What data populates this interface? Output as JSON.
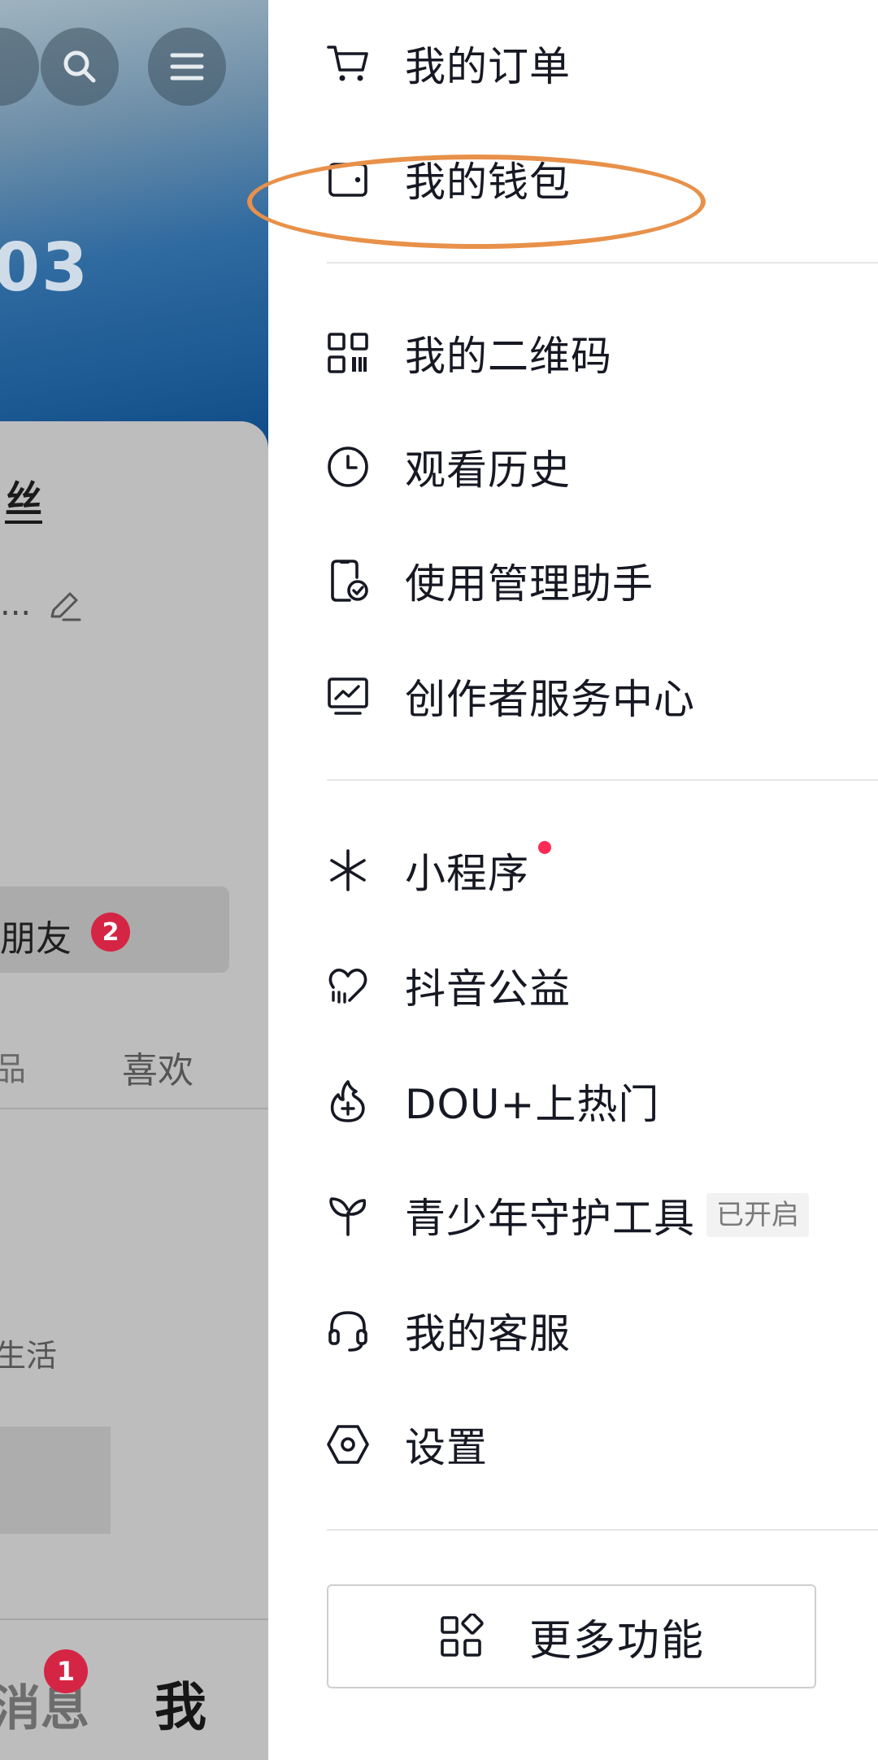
{
  "background": {
    "stat_number": "03",
    "fans_label": "丝",
    "bio_text": "...",
    "friend_button_label": "朋友",
    "friend_badge": "2",
    "tab_prev_label": "品",
    "tab_like_label": "喜欢",
    "life_text": "生活",
    "nav_messages_label": "消息",
    "nav_messages_badge": "1",
    "nav_me_label": "我"
  },
  "drawer": {
    "items": [
      {
        "label": "我的订单",
        "icon": "cart-icon"
      },
      {
        "label": "我的钱包",
        "icon": "wallet-icon"
      },
      {
        "label": "我的二维码",
        "icon": "qrcode-icon"
      },
      {
        "label": "观看历史",
        "icon": "clock-icon"
      },
      {
        "label": "使用管理助手",
        "icon": "phone-check-icon"
      },
      {
        "label": "创作者服务中心",
        "icon": "monitor-chart-icon"
      },
      {
        "label": "小程序",
        "icon": "sparkle-icon"
      },
      {
        "label": "抖音公益",
        "icon": "heart-hand-icon"
      },
      {
        "label": "DOU+上热门",
        "icon": "flame-plus-icon"
      },
      {
        "label": "青少年守护工具",
        "icon": "sprout-icon",
        "tag": "已开启"
      },
      {
        "label": "我的客服",
        "icon": "headset-icon"
      },
      {
        "label": "设置",
        "icon": "hexagon-settings-icon"
      }
    ],
    "more_button_label": "更多功能"
  },
  "colors": {
    "accent_red": "#fe2c55",
    "annotation_orange": "#e8914a",
    "text_primary": "#161823"
  }
}
